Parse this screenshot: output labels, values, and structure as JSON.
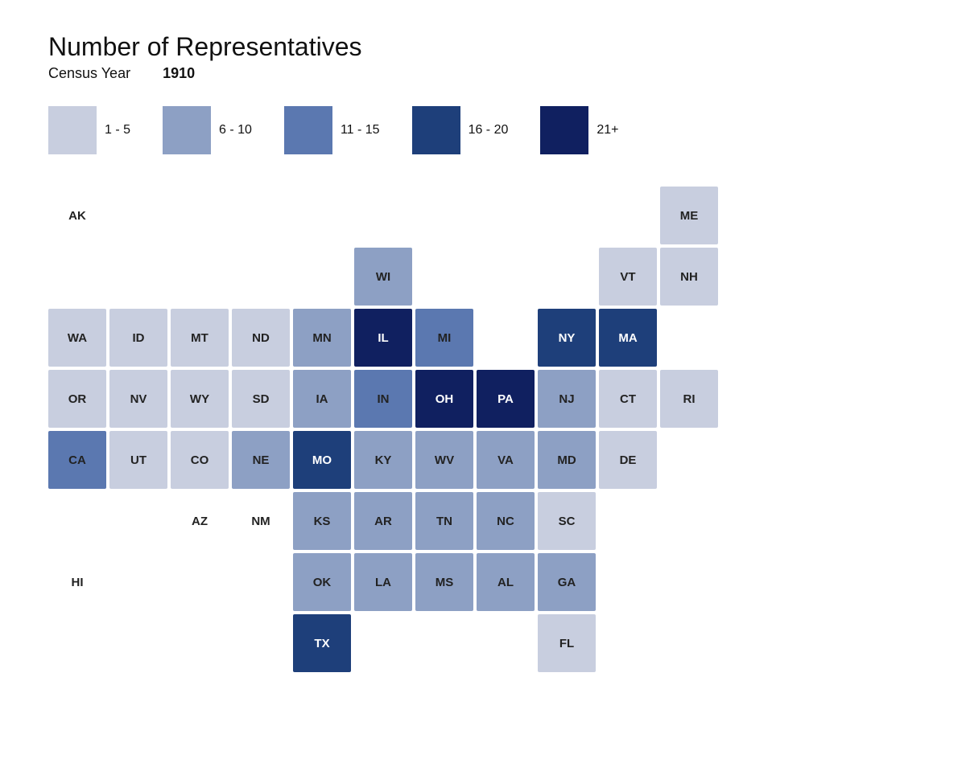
{
  "title": "Number of Representatives",
  "subtitle_label": "Census Year",
  "year": "1910",
  "legend": [
    {
      "label": "1 - 5",
      "color_class": "c1"
    },
    {
      "label": "6 - 10",
      "color_class": "c2"
    },
    {
      "label": "11 - 15",
      "color_class": "c3"
    },
    {
      "label": "16 - 20",
      "color_class": "c4"
    },
    {
      "label": "21+",
      "color_class": "c5"
    }
  ],
  "states": {
    "AK": {
      "row": 1,
      "col": 1,
      "label_only": true,
      "color": null
    },
    "ME": {
      "row": 1,
      "col": 11,
      "color_class": "c1"
    },
    "WI": {
      "row": 2,
      "col": 6,
      "color_class": "c2"
    },
    "VT": {
      "row": 2,
      "col": 10,
      "color_class": "c1"
    },
    "NH": {
      "row": 2,
      "col": 11,
      "color_class": "c1"
    },
    "WA": {
      "row": 3,
      "col": 1,
      "color_class": "c1"
    },
    "ID": {
      "row": 3,
      "col": 2,
      "color_class": "c1"
    },
    "MT": {
      "row": 3,
      "col": 3,
      "color_class": "c1"
    },
    "ND": {
      "row": 3,
      "col": 4,
      "color_class": "c1"
    },
    "MN": {
      "row": 3,
      "col": 5,
      "color_class": "c2"
    },
    "IL": {
      "row": 3,
      "col": 6,
      "color_class": "c5"
    },
    "MI": {
      "row": 3,
      "col": 7,
      "color_class": "c3"
    },
    "NY": {
      "row": 3,
      "col": 9,
      "color_class": "c4"
    },
    "MA": {
      "row": 3,
      "col": 10,
      "color_class": "c4"
    },
    "OR": {
      "row": 4,
      "col": 1,
      "color_class": "c1"
    },
    "NV": {
      "row": 4,
      "col": 2,
      "color_class": "c1"
    },
    "WY": {
      "row": 4,
      "col": 3,
      "color_class": "c1"
    },
    "SD": {
      "row": 4,
      "col": 4,
      "color_class": "c1"
    },
    "IA": {
      "row": 4,
      "col": 5,
      "color_class": "c2"
    },
    "IN": {
      "row": 4,
      "col": 6,
      "color_class": "c3"
    },
    "OH": {
      "row": 4,
      "col": 7,
      "color_class": "c5"
    },
    "PA": {
      "row": 4,
      "col": 8,
      "color_class": "c5"
    },
    "NJ": {
      "row": 4,
      "col": 9,
      "color_class": "c2"
    },
    "CT": {
      "row": 4,
      "col": 10,
      "color_class": "c1"
    },
    "RI": {
      "row": 4,
      "col": 11,
      "color_class": "c1"
    },
    "CA": {
      "row": 5,
      "col": 1,
      "color_class": "c3"
    },
    "UT": {
      "row": 5,
      "col": 2,
      "color_class": "c1"
    },
    "CO": {
      "row": 5,
      "col": 3,
      "color_class": "c1"
    },
    "NE": {
      "row": 5,
      "col": 4,
      "color_class": "c2"
    },
    "MO": {
      "row": 5,
      "col": 5,
      "color_class": "c4"
    },
    "KY": {
      "row": 5,
      "col": 6,
      "color_class": "c2"
    },
    "WV": {
      "row": 5,
      "col": 7,
      "color_class": "c2"
    },
    "VA": {
      "row": 5,
      "col": 8,
      "color_class": "c2"
    },
    "MD": {
      "row": 5,
      "col": 9,
      "color_class": "c2"
    },
    "DE": {
      "row": 5,
      "col": 10,
      "color_class": "c1"
    },
    "AZ": {
      "row": 6,
      "col": 3,
      "color_class": null,
      "label_only": true
    },
    "NM": {
      "row": 6,
      "col": 4,
      "color_class": null,
      "label_only": true
    },
    "KS": {
      "row": 6,
      "col": 5,
      "color_class": "c2"
    },
    "AR": {
      "row": 6,
      "col": 6,
      "color_class": "c2"
    },
    "TN": {
      "row": 6,
      "col": 7,
      "color_class": "c2"
    },
    "NC": {
      "row": 6,
      "col": 8,
      "color_class": "c2"
    },
    "SC": {
      "row": 6,
      "col": 9,
      "color_class": "c1"
    },
    "HI": {
      "row": 7,
      "col": 1,
      "color_class": null,
      "label_only": true
    },
    "OK": {
      "row": 7,
      "col": 5,
      "color_class": "c2"
    },
    "LA": {
      "row": 7,
      "col": 6,
      "color_class": "c2"
    },
    "MS": {
      "row": 7,
      "col": 7,
      "color_class": "c2"
    },
    "AL": {
      "row": 7,
      "col": 8,
      "color_class": "c2"
    },
    "GA": {
      "row": 7,
      "col": 9,
      "color_class": "c2"
    },
    "TX": {
      "row": 8,
      "col": 5,
      "color_class": "c4"
    },
    "FL": {
      "row": 8,
      "col": 9,
      "color_class": "c1"
    }
  },
  "dark_text_states": [
    "IL",
    "OH",
    "PA",
    "NY",
    "MA",
    "MO",
    "TX"
  ]
}
